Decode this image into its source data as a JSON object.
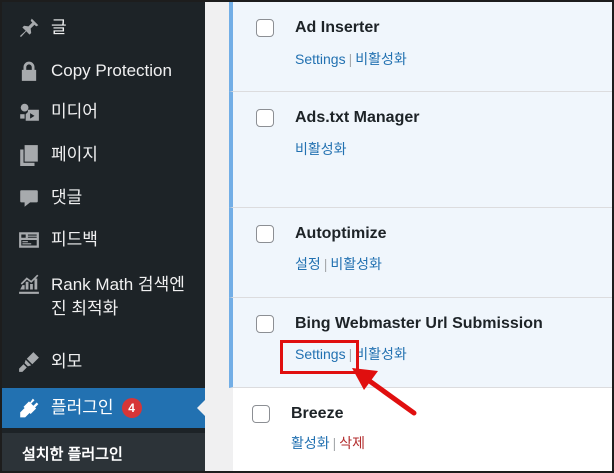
{
  "sidebar": {
    "items": [
      {
        "id": "posts",
        "label": "글",
        "icon": "pin-icon"
      },
      {
        "id": "copy-protection",
        "label": "Copy Protection",
        "icon": "lock-icon"
      },
      {
        "id": "media",
        "label": "미디어",
        "icon": "media-icon"
      },
      {
        "id": "pages",
        "label": "페이지",
        "icon": "page-icon"
      },
      {
        "id": "comments",
        "label": "댓글",
        "icon": "comment-icon"
      },
      {
        "id": "feedback",
        "label": "피드백",
        "icon": "feedback-icon"
      },
      {
        "id": "rank-math",
        "label": "Rank Math 검색엔\n진 최적화",
        "label_line1": "Rank Math 검색엔",
        "label_line2": "진 최적화",
        "icon": "chart-icon"
      },
      {
        "id": "appearance",
        "label": "외모",
        "icon": "brush-icon"
      },
      {
        "id": "plugins",
        "label": "플러그인",
        "icon": "plugin-icon",
        "badge": "4",
        "active": true
      }
    ],
    "submenu_current": "설치한 플러그인"
  },
  "plugins": [
    {
      "name": "Ad Inserter",
      "status": "active",
      "actions": [
        "Settings",
        "비활성화"
      ]
    },
    {
      "name": "Ads.txt Manager",
      "status": "active",
      "actions": [
        "비활성화"
      ]
    },
    {
      "name": "Autoptimize",
      "status": "active",
      "actions": [
        "설정",
        "비활성화"
      ]
    },
    {
      "name": "Bing Webmaster Url Submission",
      "status": "active",
      "actions": [
        "Settings",
        "비활성화"
      ]
    },
    {
      "name": "Breeze",
      "status": "inactive",
      "actions": [
        "활성화",
        "삭제"
      ]
    }
  ],
  "colors": {
    "sidebar_bg": "#1d2327",
    "active_menu": "#2271b1",
    "badge": "#d63638",
    "link": "#2271b1",
    "delete": "#b32d2e",
    "active_row_bg": "#f0f6fc",
    "annotation": "#e00f0f"
  }
}
